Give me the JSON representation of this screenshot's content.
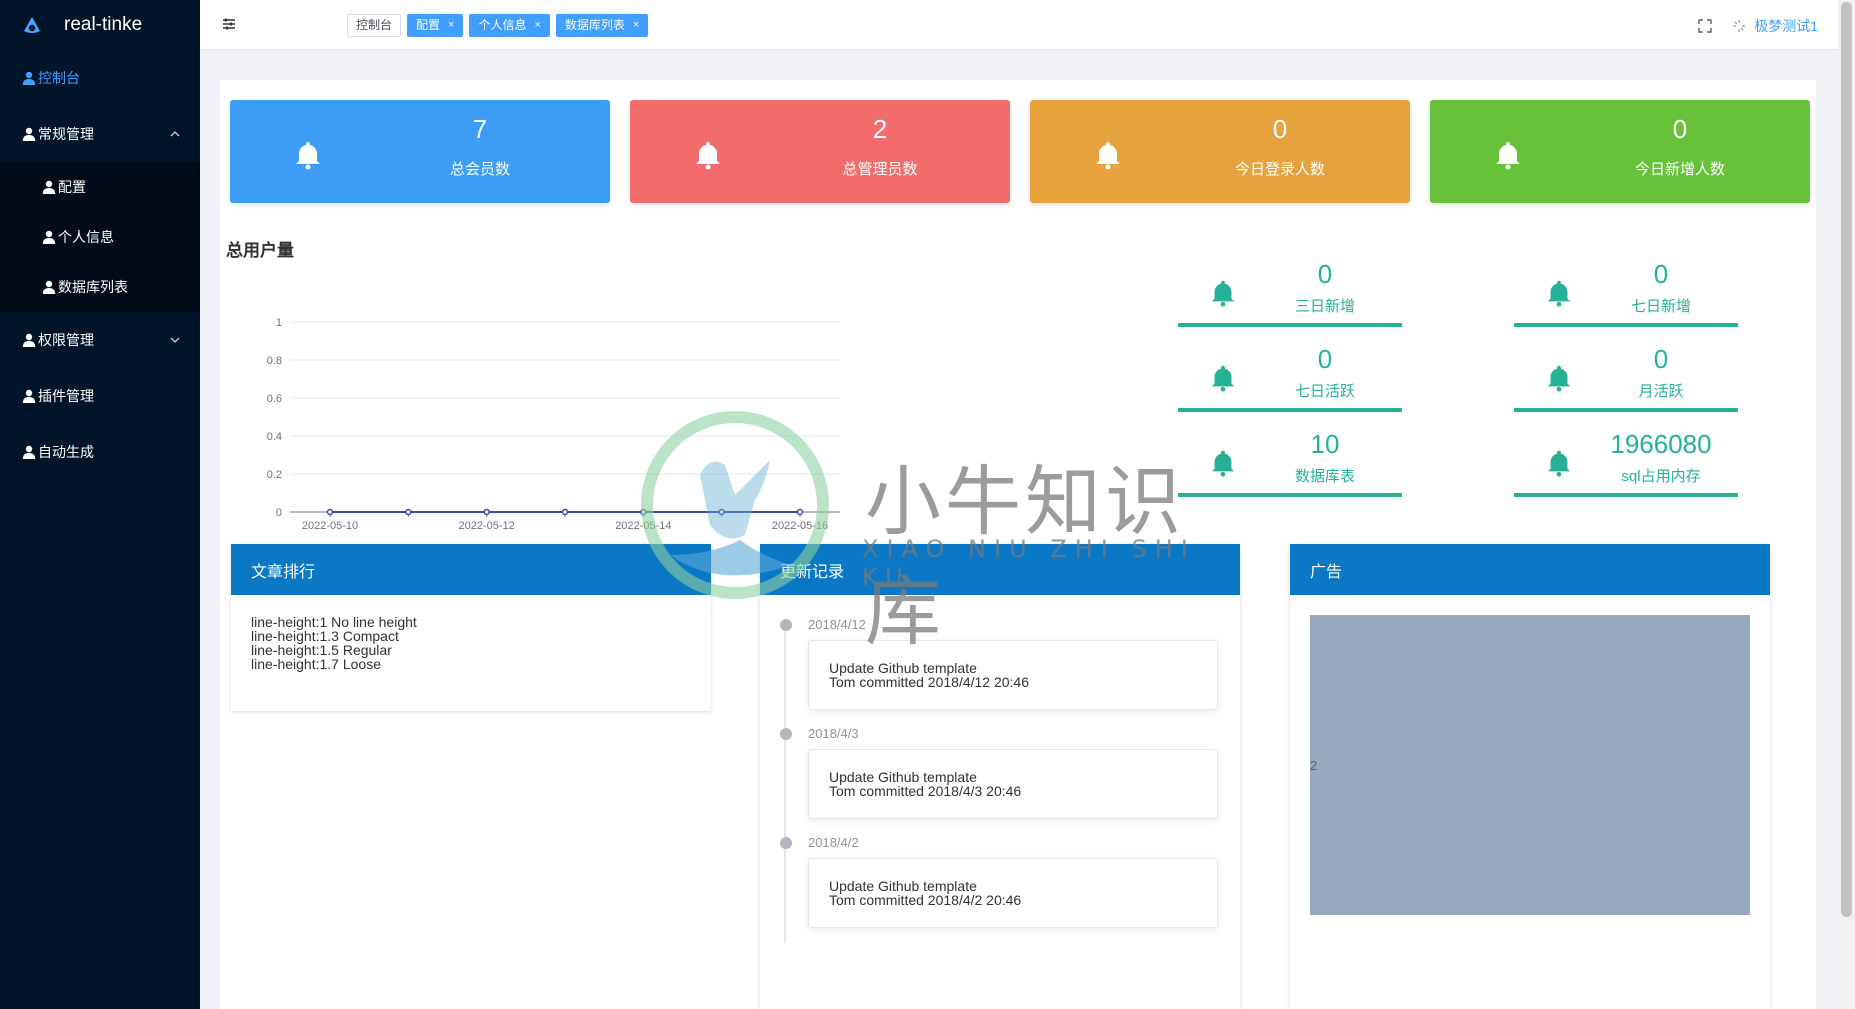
{
  "app": {
    "name": "real-tinke"
  },
  "sidebar": {
    "items": [
      {
        "label": "控制台",
        "active": true
      },
      {
        "label": "常规管理",
        "expanded": true,
        "children": [
          {
            "label": "配置"
          },
          {
            "label": "个人信息"
          },
          {
            "label": "数据库列表"
          }
        ]
      },
      {
        "label": "权限管理",
        "expanded": false
      },
      {
        "label": "插件管理"
      },
      {
        "label": "自动生成"
      }
    ]
  },
  "header": {
    "tabs": [
      {
        "label": "控制台",
        "active": false,
        "closable": false
      },
      {
        "label": "配置",
        "active": true,
        "closable": true
      },
      {
        "label": "个人信息",
        "active": true,
        "closable": true
      },
      {
        "label": "数据库列表",
        "active": true,
        "closable": true
      }
    ],
    "close_glyph": "×",
    "user_name": "极梦测试1"
  },
  "stats": [
    {
      "value": "7",
      "label": "总会员数",
      "color": "#3d9cf5"
    },
    {
      "value": "2",
      "label": "总管理员数",
      "color": "#f36c6c"
    },
    {
      "value": "0",
      "label": "今日登录人数",
      "color": "#e6a23c"
    },
    {
      "value": "0",
      "label": "今日新增人数",
      "color": "#67c23a"
    }
  ],
  "users_section": {
    "title": "总用户量"
  },
  "chart_data": {
    "type": "line",
    "x": [
      "2022-05-10",
      "2022-05-11",
      "2022-05-12",
      "2022-05-13",
      "2022-05-14",
      "2022-05-15",
      "2022-05-16"
    ],
    "x_tick_labels": [
      "2022-05-10",
      "2022-05-12",
      "2022-05-14",
      "2022-05-16"
    ],
    "series": [
      {
        "values": [
          0,
          0,
          0,
          0,
          0,
          0,
          0
        ],
        "color": "#3949ab"
      }
    ],
    "y_ticks": [
      "0",
      "0.2",
      "0.4",
      "0.6",
      "0.8",
      "1"
    ],
    "ylim": [
      0,
      1
    ],
    "grid": true
  },
  "mini_stats": [
    {
      "value": "0",
      "label": "三日新增"
    },
    {
      "value": "0",
      "label": "七日新增"
    },
    {
      "value": "0",
      "label": "七日活跃"
    },
    {
      "value": "0",
      "label": "月活跃"
    },
    {
      "value": "10",
      "label": "数据库表"
    },
    {
      "value": "1966080",
      "label": "sql占用内存"
    }
  ],
  "article_panel": {
    "title": "文章排行",
    "lines": [
      "line-height:1 No line height",
      "line-height:1.3 Compact",
      "line-height:1.5 Regular",
      "line-height:1.7 Loose"
    ]
  },
  "update_panel": {
    "title": "更新记录",
    "entries": [
      {
        "date": "2018/4/12",
        "title": "Update Github template",
        "detail": "Tom committed 2018/4/12 20:46"
      },
      {
        "date": "2018/4/3",
        "title": "Update Github template",
        "detail": "Tom committed 2018/4/3 20:46"
      },
      {
        "date": "2018/4/2",
        "title": "Update Github template",
        "detail": "Tom committed 2018/4/2 20:46"
      }
    ]
  },
  "ad_panel": {
    "title": "广告",
    "content": "2"
  },
  "watermark": {
    "cn": "小牛知识库",
    "en": "XIAO NIU ZHI SHI KU"
  },
  "colors": {
    "sidebar_bg": "#001529",
    "accent": "#409eff",
    "teal": "#26b096",
    "panel_head": "#0a78c5"
  }
}
